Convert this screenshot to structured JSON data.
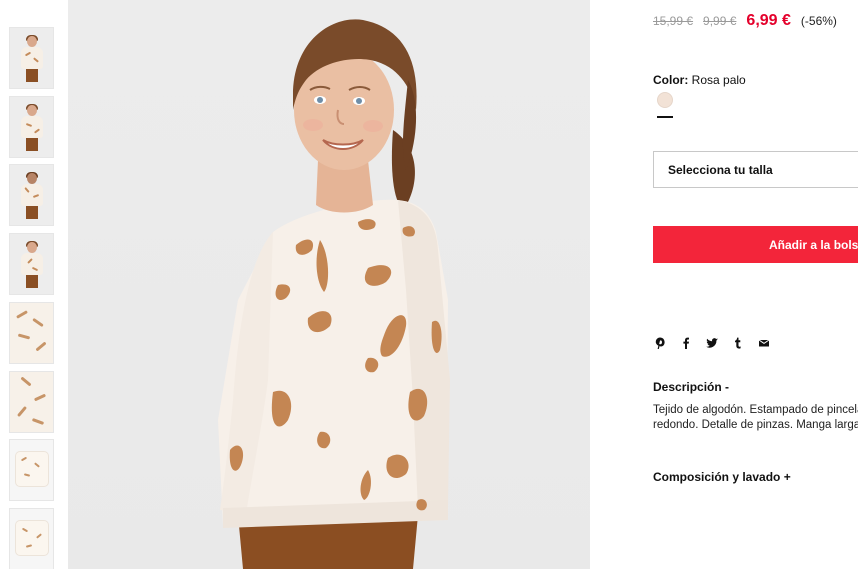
{
  "product": {
    "price_old_1": "15,99 €",
    "price_old_2": "9,99 €",
    "price_current": "6,99 €",
    "discount": "(-56%)",
    "color_label": "Color:",
    "color_value": "Rosa palo",
    "swatch_color": "#f2e2d6",
    "size_select_label": "Selecciona tu talla",
    "add_to_bag_label": "Añadir a la bolsa",
    "description_title": "Descripción -",
    "description_line_1": "Tejido de algodón. Estampado de pinceladas. Cuello",
    "description_line_2": "redondo. Detalle de pinzas. Manga larga.",
    "composition_title": "Composición y lavado +"
  },
  "social_icons": [
    "pinterest-icon",
    "facebook-icon",
    "twitter-icon",
    "tumblr-icon",
    "mail-icon"
  ],
  "thumbnails": [
    {
      "type": "model"
    },
    {
      "type": "model"
    },
    {
      "type": "model"
    },
    {
      "type": "model"
    },
    {
      "type": "fabric"
    },
    {
      "type": "fabric"
    },
    {
      "type": "flat"
    },
    {
      "type": "flat"
    }
  ],
  "colors": {
    "sale_red": "#e4002b",
    "button_red": "#f3253a",
    "strike_gray": "#9a9a9a"
  }
}
